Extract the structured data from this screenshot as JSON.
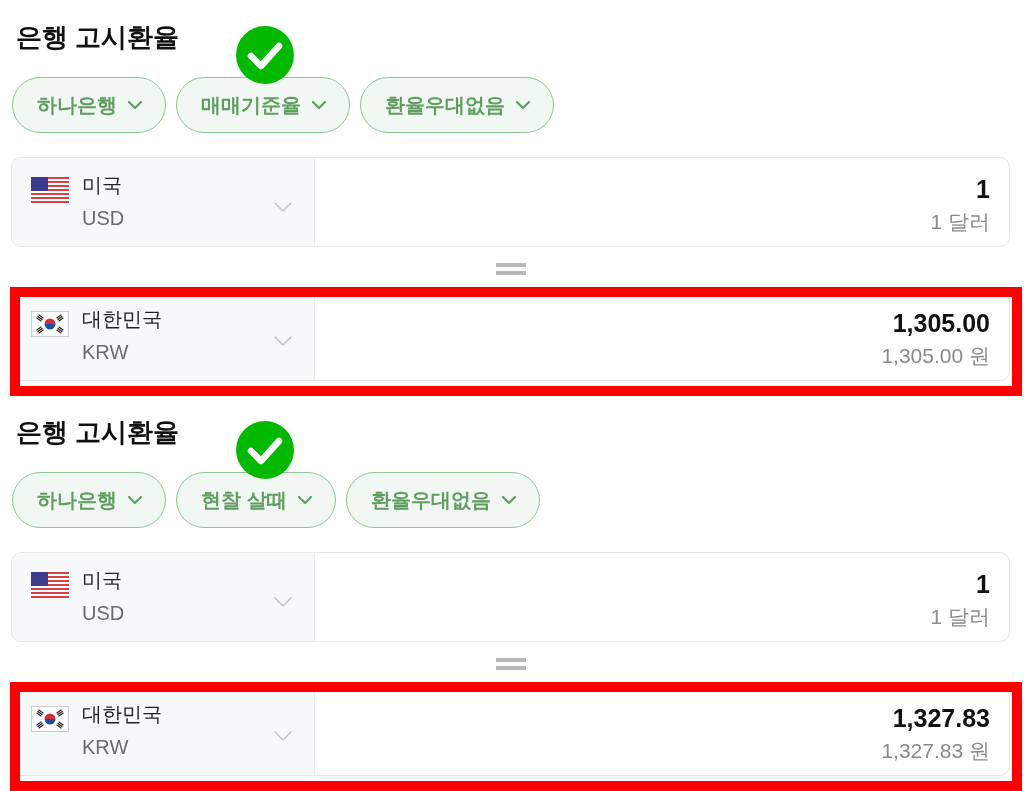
{
  "sections": [
    {
      "title": "은행 고시환율",
      "filters": [
        {
          "label": "하나은행",
          "checked": false
        },
        {
          "label": "매매기준율",
          "checked": true
        },
        {
          "label": "환율우대없음",
          "checked": false
        }
      ],
      "currencies": [
        {
          "kind": "us",
          "country": "미국",
          "code": "USD",
          "amount": "1",
          "amount_words": "1 달러",
          "highlighted": false
        },
        {
          "kind": "kr",
          "country": "대한민국",
          "code": "KRW",
          "amount": "1,305.00",
          "amount_words": "1,305.00 원",
          "highlighted": true
        }
      ]
    },
    {
      "title": "은행 고시환율",
      "filters": [
        {
          "label": "하나은행",
          "checked": false
        },
        {
          "label": "현찰 살때",
          "checked": true
        },
        {
          "label": "환율우대없음",
          "checked": false
        }
      ],
      "currencies": [
        {
          "kind": "us",
          "country": "미국",
          "code": "USD",
          "amount": "1",
          "amount_words": "1 달러",
          "highlighted": false
        },
        {
          "kind": "kr",
          "country": "대한민국",
          "code": "KRW",
          "amount": "1,327.83",
          "amount_words": "1,327.83 원",
          "highlighted": true
        }
      ]
    }
  ]
}
